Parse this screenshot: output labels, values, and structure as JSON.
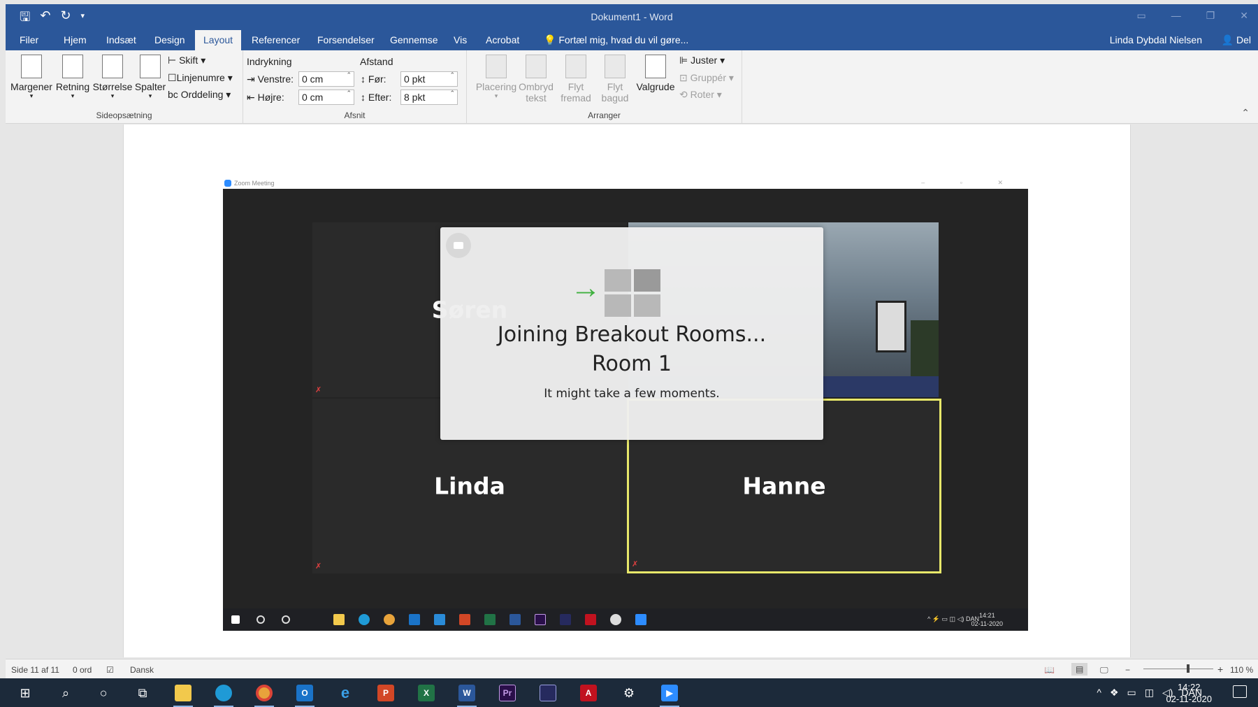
{
  "window": {
    "title": "Dokument1 - Word"
  },
  "tabs": [
    "Filer",
    "Hjem",
    "Indsæt",
    "Design",
    "Layout",
    "Referencer",
    "Forsendelser",
    "Gennemse",
    "Vis",
    "Acrobat"
  ],
  "active_tab": "Layout",
  "tell_me": "Fortæl mig, hvad du vil gøre...",
  "user_name": "Linda Dybdal Nielsen",
  "share_label": "Del",
  "ribbon": {
    "page_setup": {
      "label": "Sideopsætning",
      "margins": "Margener",
      "orientation": "Retning",
      "size": "Størrelse",
      "columns": "Spalter",
      "breaks": "Skift",
      "line_numbers": "Linjenumre",
      "hyphenation": "Orddeling"
    },
    "paragraph": {
      "label": "Afsnit",
      "indent_label": "Indrykning",
      "spacing_label": "Afstand",
      "left_label": "Venstre:",
      "left_value": "0 cm",
      "right_label": "Højre:",
      "right_value": "0 cm",
      "before_label": "Før:",
      "before_value": "0 pkt",
      "after_label": "Efter:",
      "after_value": "8 pkt"
    },
    "arrange": {
      "label": "Arranger",
      "position": "Placering",
      "wrap_1": "Ombryd",
      "wrap_2": "tekst",
      "forward_1": "Flyt",
      "forward_2": "fremad",
      "backward_1": "Flyt",
      "backward_2": "bagud",
      "selection_pane": "Valgrude",
      "align": "Juster",
      "group": "Gruppér",
      "rotate": "Roter"
    }
  },
  "zoom_window": {
    "title": "Zoom Meeting",
    "participants": [
      "Søren",
      "Linda",
      "Hanne"
    ],
    "dialog": {
      "line1": "Joining Breakout Rooms...",
      "line2": "Room 1",
      "line3": "It might take a few moments."
    },
    "tray_lang": "DAN",
    "clock_time": "14:21",
    "clock_date": "02-11-2020"
  },
  "status": {
    "page": "Side 11 af 11",
    "words": "0 ord",
    "language": "Dansk",
    "zoom": "110 %"
  },
  "taskbar": {
    "lang": "DAN",
    "time": "14:22",
    "date": "02-11-2020"
  }
}
